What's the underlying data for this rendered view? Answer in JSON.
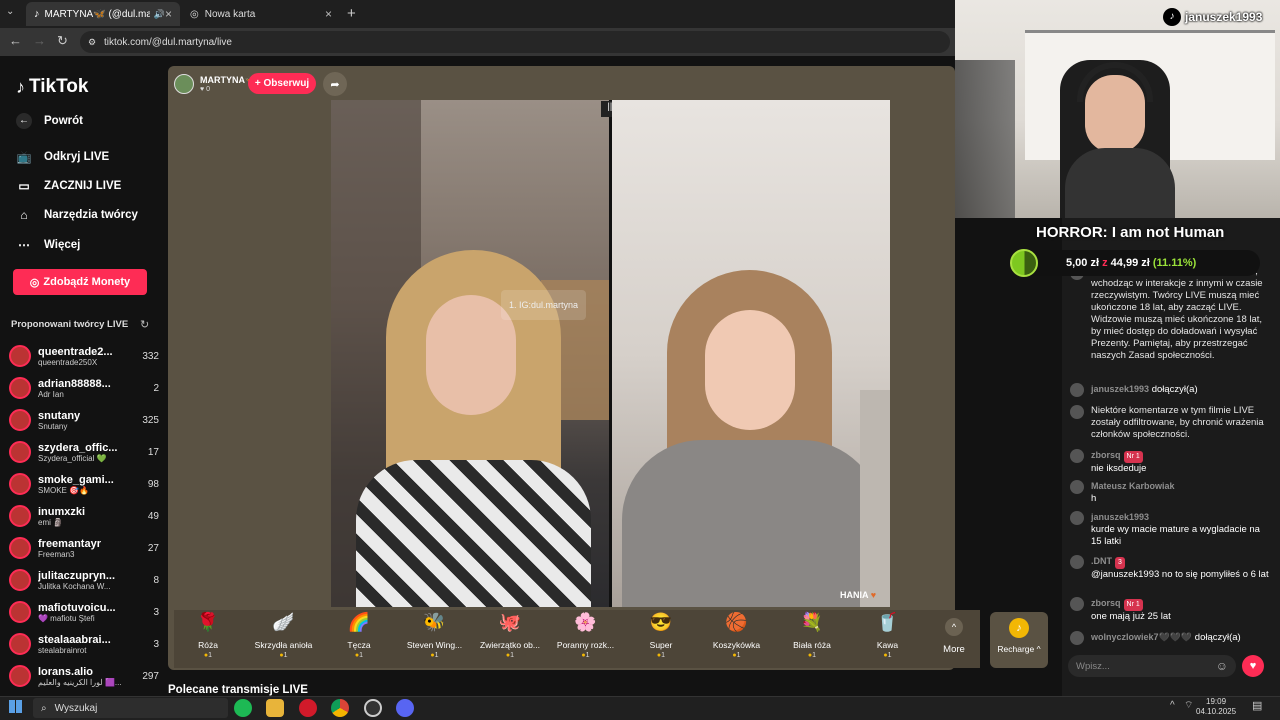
{
  "browser": {
    "tabs": [
      {
        "label": "MARTYNA🦋 (@dul.martyna..."
      },
      {
        "label": "Nowa karta"
      }
    ],
    "url": "tiktok.com/@dul.martyna/live"
  },
  "sidebar": {
    "logo": "TikTok",
    "back": "Powrót",
    "nav": [
      {
        "label": "Odkryj LIVE",
        "icon": "live-tv-icon"
      },
      {
        "label": "ZACZNIJ LIVE",
        "icon": "camera-icon"
      },
      {
        "label": "Narzędzia twórcy",
        "icon": "home-icon"
      },
      {
        "label": "Więcej",
        "icon": "more-dots-icon"
      }
    ],
    "coins_button": "Zdobądź Monety",
    "suggested_title": "Proponowani twórcy LIVE",
    "creators": [
      {
        "name": "queentrade2...",
        "handle": "queentrade250X",
        "viewers": "332"
      },
      {
        "name": "adrian88888...",
        "handle": "Adr Ian",
        "viewers": "2"
      },
      {
        "name": "snutany",
        "handle": "Snutany",
        "viewers": "325"
      },
      {
        "name": "szydera_offic...",
        "handle": "Szydera_official 💚",
        "viewers": "17"
      },
      {
        "name": "smoke_gami...",
        "handle": "SMOKE 🎯🔥",
        "viewers": "98"
      },
      {
        "name": "inumxzki",
        "handle": "emi 🗿",
        "viewers": "49"
      },
      {
        "name": "freemantayr",
        "handle": "Freeman3",
        "viewers": "27"
      },
      {
        "name": "julitaczupryn...",
        "handle": "Julitka Kochana W...",
        "viewers": "8"
      },
      {
        "name": "mafiotuvoicu...",
        "handle": "💜 mafiotu Ştefi",
        "viewers": "3"
      },
      {
        "name": "stealaaabrai...",
        "handle": "stealabrainrot",
        "viewers": "3"
      },
      {
        "name": "lorans.alio",
        "handle": "لورا الكرينيه والعليم 🟪...",
        "viewers": "297"
      }
    ]
  },
  "stream": {
    "host_name": "MARTYNA🦋",
    "host_likes": "0",
    "follow_label": "+ Obserwuj",
    "overlay_ig": "1. IG:dul.martyna",
    "guest_label": "HANIA",
    "below_title": "Polecane transmisje LIVE"
  },
  "gifts": [
    {
      "name": "Róża",
      "icon": "🌹",
      "price": "1"
    },
    {
      "name": "Skrzydła anioła",
      "icon": "🪽",
      "price": "1"
    },
    {
      "name": "Tęcza",
      "icon": "🌈",
      "price": "1"
    },
    {
      "name": "Steven Wing...",
      "icon": "🐝",
      "price": "1"
    },
    {
      "name": "Zwierzątko ob...",
      "icon": "🐙",
      "price": "1"
    },
    {
      "name": "Poranny rozk...",
      "icon": "🌸",
      "price": "1"
    },
    {
      "name": "Super",
      "icon": "😎",
      "price": "1"
    },
    {
      "name": "Koszykówka",
      "icon": "🏀",
      "price": "1"
    },
    {
      "name": "Biała róża",
      "icon": "💐",
      "price": "1"
    },
    {
      "name": "Kawa",
      "icon": "🥤",
      "price": "1"
    }
  ],
  "gift_more": "More",
  "recharge": "Recharge ^",
  "overlay": {
    "streamer": "januszek1993",
    "title": "HORROR: I am not Human",
    "goal_current": "5,00 zł",
    "goal_sep": "z",
    "goal_target": "44,99 zł",
    "goal_percent": "(11.11%)",
    "goal_fraction": 0.1111
  },
  "chat": {
    "messages": [
      {
        "user": "",
        "text": "Witamy w TikTok LIVE! Baw się dobrze, wchodząc w interakcje z innymi w czasie rzeczywistym. Twórcy LIVE muszą mieć ukończone 18 lat, aby zacząć LIVE. Widzowie muszą mieć ukończone 18 lat, by mieć dostęp do doładowań i wysyłać Prezenty. Pamiętaj, aby przestrzegać naszych Zasad społeczności."
      },
      {
        "user": "januszek1993",
        "text": "dołączył(a)"
      },
      {
        "user": "",
        "text": "Niektóre komentarze w tym filmie LIVE zostały odfiltrowane, by chronić wrażenia członków społeczności."
      },
      {
        "user": "zborsq",
        "badge": "Nr 1",
        "text": "nie iksdeduje"
      },
      {
        "user": "Mateusz Karbowiak",
        "text": "h"
      },
      {
        "user": "januszek1993",
        "text": "kurde wy macie mature a wygladacie na 15 latki"
      },
      {
        "user": ".DNT",
        "badge": "3",
        "text": "@januszek1993 no to się pomyliłeś o 6 lat"
      },
      {
        "user": "zborsq",
        "badge": "Nr 1",
        "text": "one mają już 25 lat"
      },
      {
        "user": "wolnyczlowiek7🖤🖤🖤",
        "text": "dołączył(a)"
      }
    ],
    "input_placeholder": "Wpisz..."
  },
  "taskbar": {
    "search": "Wyszukaj",
    "time": "19:09",
    "date": "04.10.2025"
  }
}
